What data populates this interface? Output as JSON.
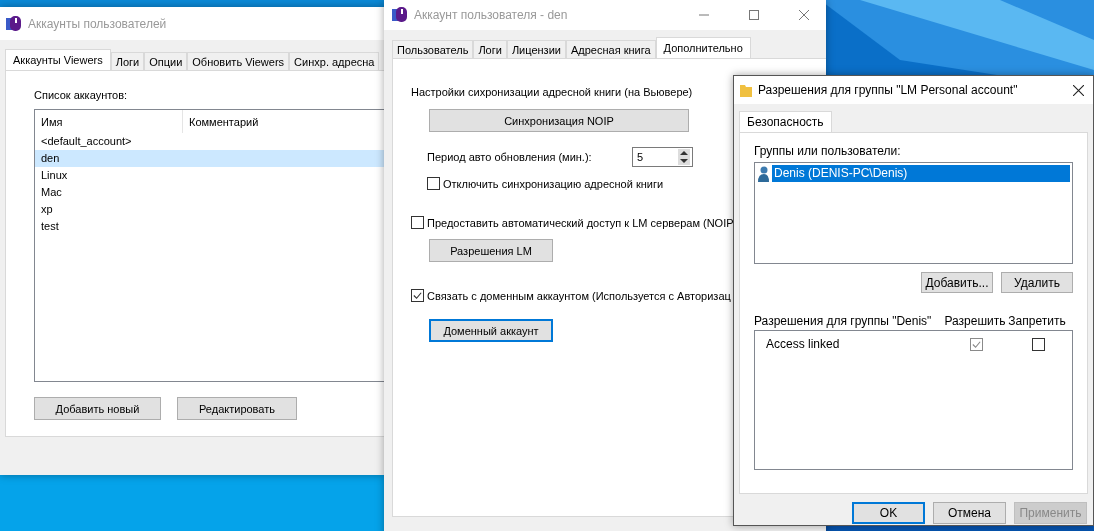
{
  "accounts_window": {
    "title": "Аккаунты пользователей",
    "tabs": [
      {
        "label": "Аккаунты Viewers",
        "selected": true
      },
      {
        "label": "Логи",
        "selected": false
      },
      {
        "label": "Опции",
        "selected": false
      },
      {
        "label": "Обновить Viewers",
        "selected": false
      },
      {
        "label": "Синхр. адресна",
        "selected": false
      }
    ],
    "list_label": "Список аккаунтов:",
    "columns": [
      "Имя",
      "Комментарий"
    ],
    "rows": [
      {
        "name": "<default_account>",
        "selected": false
      },
      {
        "name": "den",
        "selected": true
      },
      {
        "name": "Linux",
        "selected": false
      },
      {
        "name": "Mac",
        "selected": false
      },
      {
        "name": "xp",
        "selected": false
      },
      {
        "name": "test",
        "selected": false
      }
    ],
    "buttons": [
      "Добавить новый",
      "Редактировать"
    ]
  },
  "account_window": {
    "title": "Аккаунт пользователя - den",
    "tabs": [
      {
        "label": "Пользователь",
        "selected": false
      },
      {
        "label": "Логи",
        "selected": false
      },
      {
        "label": "Лицензии",
        "selected": false
      },
      {
        "label": "Адресная книга",
        "selected": false
      },
      {
        "label": "Дополнительно",
        "selected": true
      }
    ],
    "sync_heading": "Настройки сихронизации адресной книги (на Вьювере)",
    "noip_button": {
      "label": "Синхронизация NOIP",
      "focused": false
    },
    "period_label": "Период авто обновления (мин.):",
    "period_value": "5",
    "disable_sync": {
      "label": "Отключить синхронизацию адресной книги",
      "checked": false
    },
    "auto_access": {
      "label": "Предоставить автоматический доступ к LM серверам (NOIP",
      "checked": false
    },
    "lm_button": {
      "label": "Разрешения LM",
      "focused": false
    },
    "link_domain": {
      "label": "Связать с доменным аккаунтом (Используется с Авторизац",
      "checked": true
    },
    "domain_button": {
      "label": "Доменный аккаунт",
      "focused": true
    }
  },
  "permissions_window": {
    "title": "Разрешения для группы \"LM Personal account\"",
    "tabs": [
      {
        "label": "Безопасность",
        "selected": true
      }
    ],
    "groups_label": "Группы или пользователи:",
    "groups": [
      {
        "name": "Denis (DENIS-PC\\Denis)",
        "selected": true
      }
    ],
    "add_button": "Добавить...",
    "remove_button": "Удалить",
    "perm_label": "Разрешения для группы \"Denis\"",
    "columns": [
      "Разрешить",
      "Запретить"
    ],
    "permissions": [
      {
        "name": "Access linked",
        "allow": {
          "checked": true,
          "disabled": true
        },
        "deny": {
          "checked": false,
          "disabled": false
        }
      }
    ],
    "buttons": [
      {
        "label": "OK",
        "focused": true,
        "disabled": false
      },
      {
        "label": "Отмена",
        "focused": false,
        "disabled": false
      },
      {
        "label": "Применить",
        "focused": false,
        "disabled": true
      }
    ]
  }
}
